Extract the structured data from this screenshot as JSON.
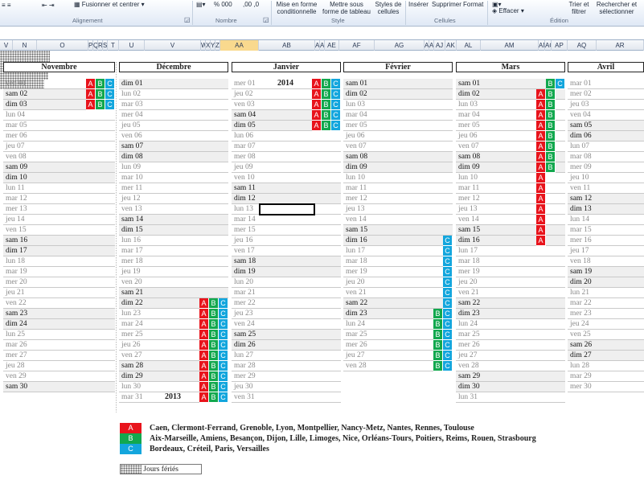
{
  "ribbon": {
    "align_indent": "≡ ≡",
    "merge_label": "Fusionner et centrer",
    "merge_caret": "▾",
    "nombre_format": "% 000",
    "dec_buttons": ",00 ,0",
    "group_alignement": "Alignement",
    "group_nombre": "Nombre",
    "group_style": "Style",
    "group_cellules": "Cellules",
    "group_edition": "Édition",
    "style_btn1": "Mise en forme conditionnelle",
    "style_btn2": "Mettre sous forme de tableau",
    "style_btn3": "Styles de cellules",
    "cell_insert": "Insérer",
    "cell_delete": "Supprimer",
    "cell_format": "Format",
    "effacer": "Effacer",
    "trier": "Trier et filtrer",
    "rechercher": "Rechercher et sélectionner"
  },
  "column_headers": [
    "V",
    "N",
    "O",
    "P",
    "Q",
    "R",
    "S",
    "T",
    "U",
    "V",
    "W",
    "X",
    "Y",
    "Z",
    "AA",
    "AB",
    "AC",
    "AD",
    "AE",
    "AF",
    "AG",
    "AH",
    "AI",
    "AJ",
    "AK",
    "AL",
    "AM",
    "AN",
    "AO",
    "AP",
    "AQ",
    "AR",
    "AS"
  ],
  "months": [
    {
      "name": "Novembre",
      "days": [
        "ven 01",
        "sam 02",
        "dim 03",
        "lun 04",
        "mar 05",
        "mer 06",
        "jeu 07",
        "ven 08",
        "sam 09",
        "dim 10",
        "lun 11",
        "mar 12",
        "mer 13",
        "jeu 14",
        "ven 15",
        "sam 16",
        "dim 17",
        "lun 18",
        "mar 19",
        "mer 20",
        "jeu 21",
        "ven 22",
        "sam 23",
        "dim 24",
        "lun 25",
        "mar 26",
        "mer 27",
        "jeu 28",
        "ven 29",
        "sam 30"
      ]
    },
    {
      "name": "Décembre",
      "year": "2013",
      "days": [
        "dim 01",
        "lun 02",
        "mar 03",
        "mer 04",
        "jeu 05",
        "ven 06",
        "sam 07",
        "dim 08",
        "lun 09",
        "mar 10",
        "mer 11",
        "jeu 12",
        "ven 13",
        "sam 14",
        "dim 15",
        "lun 16",
        "mar 17",
        "mer 18",
        "jeu 19",
        "ven 20",
        "sam 21",
        "dim 22",
        "lun 23",
        "mar 24",
        "mer 25",
        "jeu 26",
        "ven 27",
        "sam 28",
        "dim 29",
        "lun 30",
        "mar 31"
      ]
    },
    {
      "name": "Janvier",
      "year": "2014",
      "days": [
        "mer 01",
        "jeu 02",
        "ven 03",
        "sam 04",
        "dim 05",
        "lun 06",
        "mar 07",
        "mer 08",
        "jeu 09",
        "ven 10",
        "sam 11",
        "dim 12",
        "lun 13",
        "mar 14",
        "mer 15",
        "jeu 16",
        "ven 17",
        "sam 18",
        "dim 19",
        "lun 20",
        "mar 21",
        "mer 22",
        "jeu 23",
        "ven 24",
        "sam 25",
        "dim 26",
        "lun 27",
        "mar 28",
        "mer 29",
        "jeu 30",
        "ven 31"
      ]
    },
    {
      "name": "Février",
      "days": [
        "sam 01",
        "dim 02",
        "lun 03",
        "mar 04",
        "mer 05",
        "jeu 06",
        "ven 07",
        "sam 08",
        "dim 09",
        "lun 10",
        "mar 11",
        "mer 12",
        "jeu 13",
        "ven 14",
        "sam 15",
        "dim 16",
        "lun 17",
        "mar 18",
        "mer 19",
        "jeu 20",
        "ven 21",
        "sam 22",
        "dim 23",
        "lun 24",
        "mar 25",
        "mer 26",
        "jeu 27",
        "ven 28"
      ]
    },
    {
      "name": "Mars",
      "days": [
        "sam 01",
        "dim 02",
        "lun 03",
        "mar 04",
        "mer 05",
        "jeu 06",
        "ven 07",
        "sam 08",
        "dim 09",
        "lun 10",
        "mar 11",
        "mer 12",
        "jeu 13",
        "ven 14",
        "sam 15",
        "dim 16",
        "lun 17",
        "mar 18",
        "mer 19",
        "jeu 20",
        "ven 21",
        "sam 22",
        "dim 23",
        "lun 24",
        "mar 25",
        "mer 26",
        "jeu 27",
        "ven 28",
        "sam 29",
        "dim 30",
        "lun 31"
      ]
    },
    {
      "name": "Avril",
      "days": [
        "mar 01",
        "mer 02",
        "jeu 03",
        "ven 04",
        "sam 05",
        "dim 06",
        "lun 07",
        "mar 08",
        "mer 09",
        "jeu 10",
        "ven 11",
        "sam 12",
        "dim 13",
        "lun 14",
        "mar 15",
        "mer 16",
        "jeu 17",
        "ven 18",
        "sam 19",
        "dim 20",
        "lun 21",
        "mar 22",
        "mer 23",
        "jeu 24",
        "ven 25",
        "sam 26",
        "dim 27",
        "lun 28",
        "mar 29",
        "mer 30"
      ]
    }
  ],
  "zones": {
    "A": "A",
    "B": "B",
    "C": "C"
  },
  "legend": [
    {
      "zone": "A",
      "text": "Caen, Clermont-Ferrand, Grenoble, Lyon, Montpellier, Nancy-Metz, Nantes, Rennes, Toulouse"
    },
    {
      "zone": "B",
      "text": "Aix-Marseille, Amiens, Besançon, Dijon, Lille, Limoges, Nice, Orléans-Tours, Poitiers, Reims, Rouen, Strasbourg"
    },
    {
      "zone": "C",
      "text": "Bordeaux, Créteil, Paris, Versailles"
    }
  ],
  "holiday_label": "Jours fériés",
  "colors": {
    "zone_a": "#e8141c",
    "zone_b": "#12a84e",
    "zone_c": "#13a6dd",
    "selected_col": "#f9d98e"
  }
}
